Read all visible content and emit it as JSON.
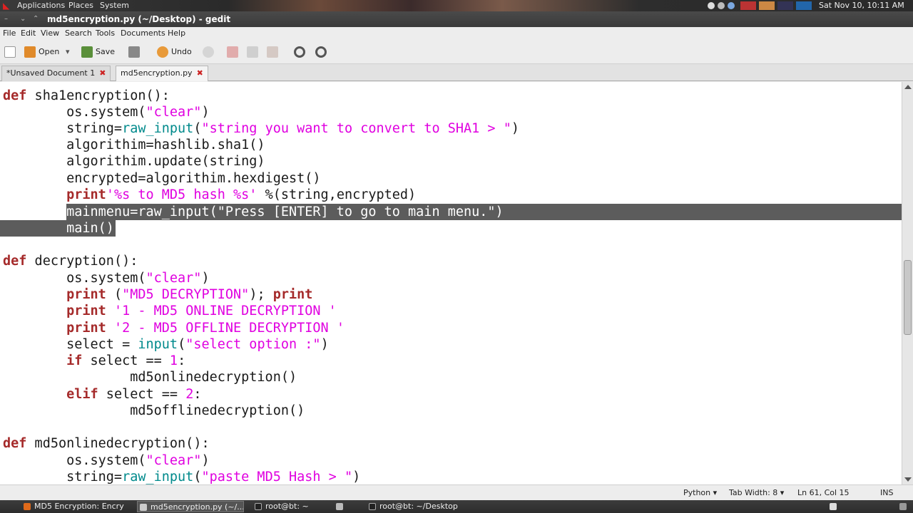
{
  "top_panel": {
    "menus": [
      "Applications",
      "Places",
      "System"
    ],
    "clock": "Sat Nov 10, 10:11 AM"
  },
  "window": {
    "title": "md5encryption.py (~/Desktop) - gedit"
  },
  "menubar": [
    "File",
    "Edit",
    "View",
    "Search",
    "Tools",
    "Documents",
    "Help"
  ],
  "toolbar": {
    "open_label": "Open",
    "save_label": "Save",
    "undo_label": "Undo"
  },
  "tabs": [
    {
      "label": "*Unsaved Document 1"
    },
    {
      "label": "md5encryption.py"
    }
  ],
  "code": {
    "l1_def": "def",
    "l1_rest": " sha1encryption():",
    "l2_a": "        os.system(",
    "l2_s": "\"clear\"",
    "l2_b": ")",
    "l3_a": "        string=",
    "l3_bi": "raw_input",
    "l3_b": "(",
    "l3_s": "\"string you want to convert to SHA1 > \"",
    "l3_c": ")",
    "l4": "        algorithim=hashlib.sha1()",
    "l5": "        algorithim.update(string)",
    "l6": "        encrypted=algorithim.hexdigest()",
    "l7_pad": "        ",
    "l7_kw": "print",
    "l7_s": "'%s to MD5 hash %s'",
    "l7_b": " %(string,encrypted)",
    "l8": "        mainmenu=raw_input(\"Press [ENTER] to go to main menu.\")",
    "l9": "        main()",
    "l11_def": "def",
    "l11_rest": " decryption():",
    "l12_a": "        os.system(",
    "l12_s": "\"clear\"",
    "l12_b": ")",
    "l13_pad": "        ",
    "l13_kw": "print",
    "l13_a": " (",
    "l13_s": "\"MD5 DECRYPTION\"",
    "l13_b": "); ",
    "l13_kw2": "print",
    "l14_pad": "        ",
    "l14_kw": "print",
    "l14_s": " '1 - MD5 ONLINE DECRYPTION '",
    "l15_pad": "        ",
    "l15_kw": "print",
    "l15_s": " '2 - MD5 OFFLINE DECRYPTION '",
    "l16_a": "        select = ",
    "l16_bi": "input",
    "l16_b": "(",
    "l16_s": "\"select option :\"",
    "l16_c": ")",
    "l17_pad": "        ",
    "l17_kw": "if",
    "l17_a": " select == ",
    "l17_n": "1",
    "l17_b": ":",
    "l18": "                md5onlinedecryption()",
    "l19_pad": "        ",
    "l19_kw": "elif",
    "l19_a": " select == ",
    "l19_n": "2",
    "l19_b": ":",
    "l20": "                md5offlinedecryption()",
    "l22_def": "def",
    "l22_rest": " md5onlinedecryption():",
    "l23_a": "        os.system(",
    "l23_s": "\"clear\"",
    "l23_b": ")",
    "l24_a": "        string=",
    "l24_bi": "raw_input",
    "l24_b": "(",
    "l24_s": "\"paste MD5 Hash > \"",
    "l24_c": ")"
  },
  "statusbar": {
    "language": "Python ▾",
    "tab_width": "Tab Width: 8 ▾",
    "position": "Ln 61, Col 15",
    "mode": "INS"
  },
  "taskbar": [
    {
      "label": "MD5 Encryption: Encry"
    },
    {
      "label": "md5encryption.py (~/..."
    },
    {
      "label": "root@bt: ~"
    },
    {
      "label": "root@bt: ~/Desktop"
    }
  ],
  "colors": {
    "keyword": "#a52a2a",
    "string": "#e000e0",
    "builtin": "#008a8c",
    "selection": "#5c5c5c"
  }
}
